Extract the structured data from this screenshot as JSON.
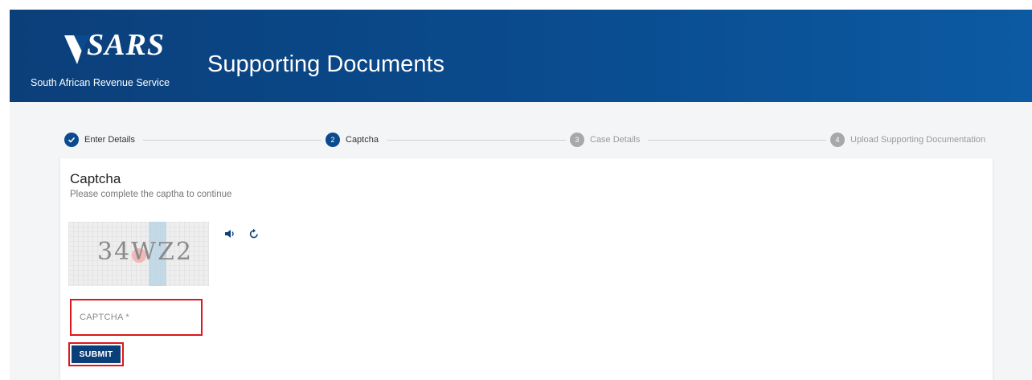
{
  "header": {
    "logo_text": "SARS",
    "logo_subtitle": "South African Revenue Service",
    "title": "Supporting Documents",
    "bg_color": "#0b4a8f"
  },
  "stepper": {
    "steps": [
      {
        "number": "1",
        "label": "Enter Details",
        "state": "done"
      },
      {
        "number": "2",
        "label": "Captcha",
        "state": "active"
      },
      {
        "number": "3",
        "label": "Case Details",
        "state": "pending"
      },
      {
        "number": "4",
        "label": "Upload Supporting Documentation",
        "state": "pending"
      }
    ],
    "active_color": "#0b4a8f",
    "pending_color": "#a8a8a8"
  },
  "card": {
    "title": "Captcha",
    "subtitle": "Please complete the captha to continue",
    "captcha_image_text": "34WZ2",
    "audio_icon": "speaker-icon",
    "refresh_icon": "refresh-icon",
    "field_placeholder": "CAPTCHA *",
    "field_value": "",
    "submit_label": "SUBMIT",
    "highlight_color": "#e0161b"
  }
}
